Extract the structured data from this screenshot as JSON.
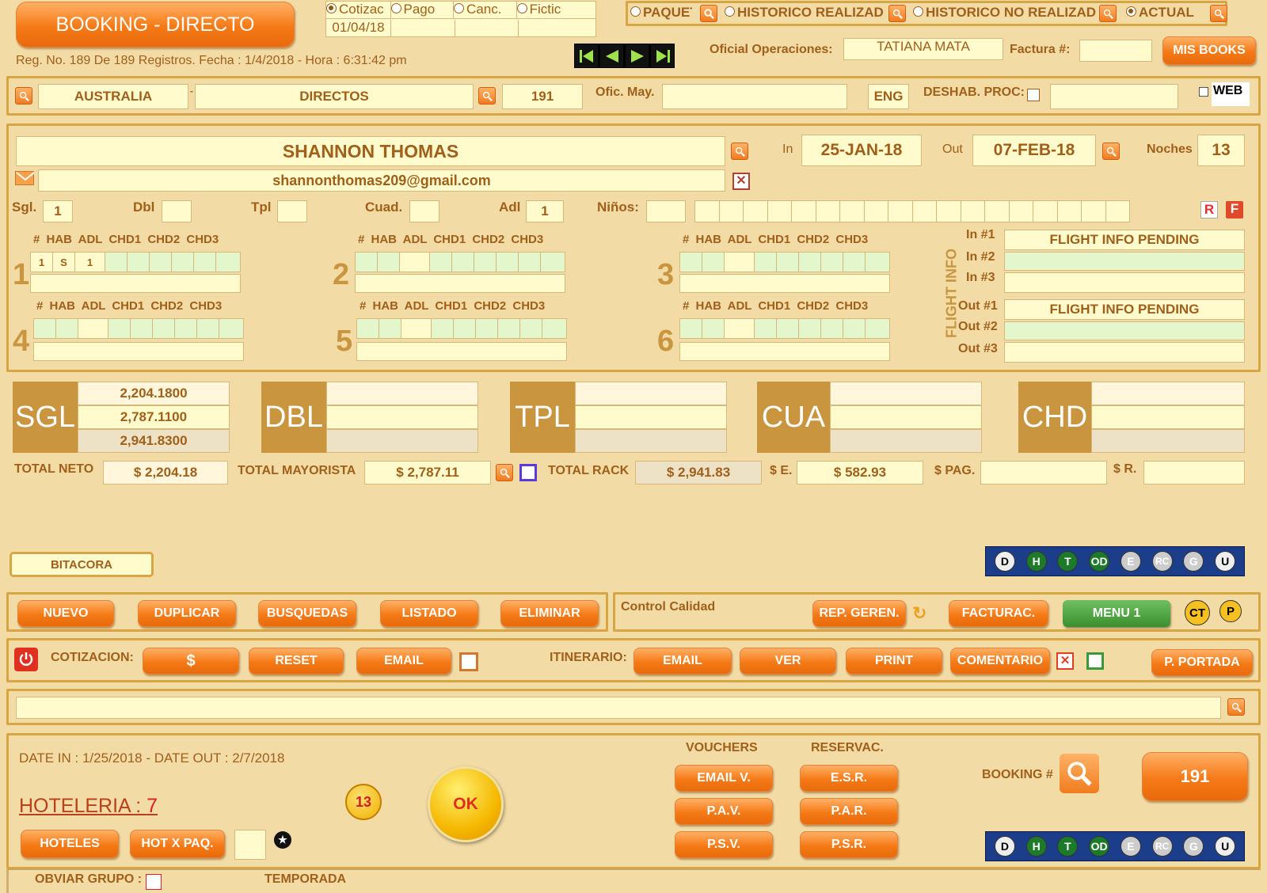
{
  "header": {
    "title": "BOOKING - DIRECTO",
    "reg_info": "Reg. No. 189 De 189 Registros. Fecha : 1/4/2018 - Hora : 6:31:42 pm",
    "status_options": [
      "Cotizac",
      "Pago",
      "Canc.",
      "Fictic"
    ],
    "status_date": "01/04/18",
    "filter_options": [
      "PAQUET",
      "HISTORICO REALIZAD",
      "HISTORICO NO REALIZAD",
      "ACTUAL"
    ],
    "oficial_label": "Oficial Operaciones:",
    "oficial_value": "TATIANA MATA",
    "factura_label": "Factura #:",
    "factura_value": "",
    "mis_books": "MIS BOOKS"
  },
  "agency": {
    "country": "AUSTRALIA",
    "sep": "-",
    "channel": "DIRECTOS",
    "code": "191",
    "ofic_label": "Ofic. May.",
    "ofic_value": "",
    "lang": "ENG",
    "deshab_label": "DESHAB. PROC:",
    "web_label": "WEB"
  },
  "guest": {
    "name": "SHANNON THOMAS",
    "email": "shannonthomas209@gmail.com",
    "in_label": "In",
    "in_date": "25-JAN-18",
    "out_label": "Out",
    "out_date": "07-FEB-18",
    "noches_label": "Noches",
    "noches": "13"
  },
  "occupancy": {
    "sgl_label": "Sgl.",
    "sgl": "1",
    "dbl_label": "Dbl",
    "dbl": "",
    "tpl_label": "Tpl",
    "tpl": "",
    "cuad_label": "Cuad.",
    "cuad": "",
    "adl_label": "Adl",
    "adl": "1",
    "ninos_label": "Niños:",
    "ninos": "",
    "r": "R",
    "f": "F"
  },
  "rooms": {
    "header": "# HAB ADL CHD1 CHD2 CHD3",
    "numbers": [
      "1",
      "2",
      "3",
      "4",
      "5",
      "6"
    ],
    "room1": [
      "1",
      "S",
      "1"
    ]
  },
  "flight": {
    "title": "FLIGHT INFO",
    "in1": "In #1",
    "in2": "In #2",
    "in3": "In #3",
    "out1": "Out #1",
    "out2": "Out #2",
    "out3": "Out #3",
    "in1_value": "FLIGHT INFO PENDING",
    "out1_value": "FLIGHT INFO PENDING"
  },
  "rates": {
    "sgl": "SGL",
    "dbl": "DBL",
    "tpl": "TPL",
    "cua": "CUA",
    "chd": "CHD",
    "sgl_values": [
      "2,204.1800",
      "2,787.1100",
      "2,941.8300"
    ]
  },
  "totals": {
    "neto_label": "TOTAL NETO",
    "neto": "$ 2,204.18",
    "may_label": "TOTAL MAYORISTA",
    "may": "$ 2,787.11",
    "rack_label": "TOTAL RACK",
    "rack": "$ 2,941.83",
    "e_label": "$ E.",
    "e": "$ 582.93",
    "pag_label": "$ PAG.",
    "pag": "",
    "r_label": "$ R.",
    "r": ""
  },
  "bitacora": "BITACORA",
  "status_circles": [
    "D",
    "H",
    "T",
    "OD",
    "E",
    "RC",
    "G",
    "U"
  ],
  "actions": {
    "nuevo": "NUEVO",
    "duplicar": "DUPLICAR",
    "busquedas": "BUSQUEDAS",
    "listado": "LISTADO",
    "eliminar": "ELIMINAR",
    "control": "Control Calidad",
    "rep": "REP. GEREN.",
    "facturac": "FACTURAC.",
    "menu1": "MENU 1",
    "ct": "CT",
    "p": "P"
  },
  "cotizacion": {
    "label": "COTIZACION:",
    "dollar": "$",
    "reset": "RESET",
    "email": "EMAIL",
    "itin_label": "ITINERARIO:",
    "itin_email": "EMAIL",
    "ver": "VER",
    "print": "PRINT",
    "comentario": "COMENTARIO",
    "portada": "P. PORTADA"
  },
  "bottom": {
    "dates": "DATE IN : 1/25/2018 - DATE OUT : 2/7/2018",
    "hoteleria_label": "HOTELERIA : ",
    "hoteleria_count": "7",
    "circle13": "13",
    "ok": "OK",
    "vouchers": "VOUCHERS",
    "reservac": "RESERVAC.",
    "email_v": "EMAIL V.",
    "pav": "P.A.V.",
    "psv": "P.S.V.",
    "esr": "E.S.R.",
    "par": "P.A.R.",
    "psr": "P.S.R.",
    "booking_label": "BOOKING #",
    "booking_num": "191",
    "hoteles": "HOTELES",
    "hotxpaq": "HOT X PAQ.",
    "obviar": "OBVIAR GRUPO :",
    "temporada": "TEMPORADA"
  }
}
